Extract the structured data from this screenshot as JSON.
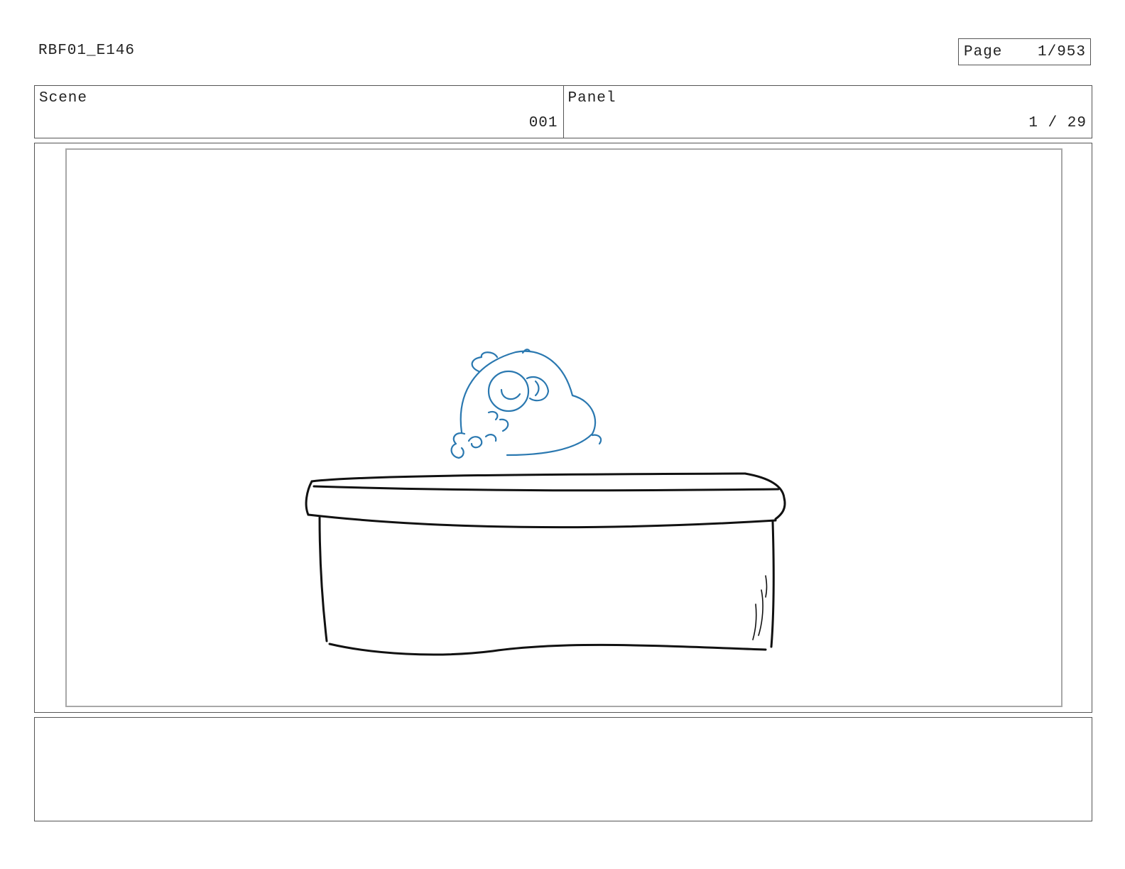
{
  "header": {
    "production_id": "RBF01_E146",
    "page_label": "Page",
    "page_value": "1/953"
  },
  "info": {
    "scene_label": "Scene",
    "scene_value": "001",
    "panel_label": "Panel",
    "panel_value": "1 / 29"
  },
  "colors": {
    "border": "#555555",
    "frame": "#a8a8a8",
    "ink": "#111111",
    "character_line": "#2a78b0"
  },
  "notes": {
    "text": ""
  }
}
